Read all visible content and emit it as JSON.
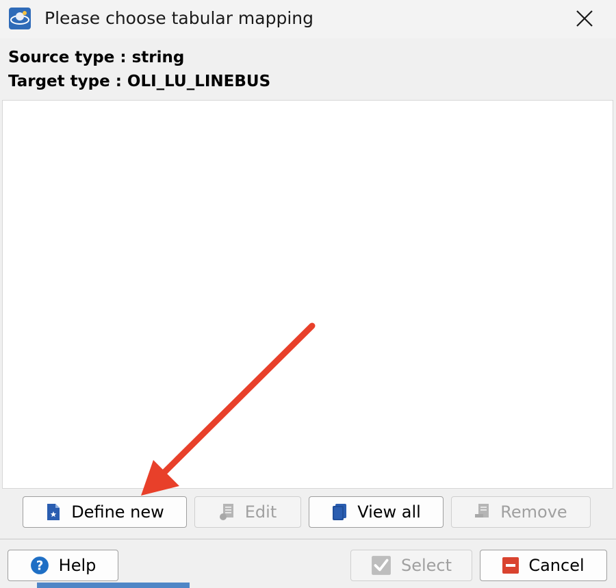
{
  "window": {
    "title": "Please choose tabular mapping"
  },
  "info": {
    "source_type": "Source type : string",
    "target_type": "Target type : OLI_LU_LINEBUS"
  },
  "mapping_list": {
    "items": []
  },
  "actions": {
    "define_new": "Define new",
    "edit": "Edit",
    "view_all": "View all",
    "remove": "Remove"
  },
  "footer": {
    "help": "Help",
    "select": "Select",
    "cancel": "Cancel"
  },
  "colors": {
    "arrow": "#e8402a",
    "primary_blue": "#2a5db0",
    "help_blue": "#1f6fc5",
    "cancel_red": "#d9432f",
    "disabled_gray": "#a0a0a0"
  },
  "icons": {
    "app": "app-logo-icon",
    "close": "close-icon",
    "define_new": "new-document-icon",
    "edit": "edit-document-icon",
    "view_all": "book-icon",
    "remove": "remove-document-icon",
    "help": "help-circle-icon",
    "select": "checkmark-icon",
    "cancel": "minus-icon"
  }
}
